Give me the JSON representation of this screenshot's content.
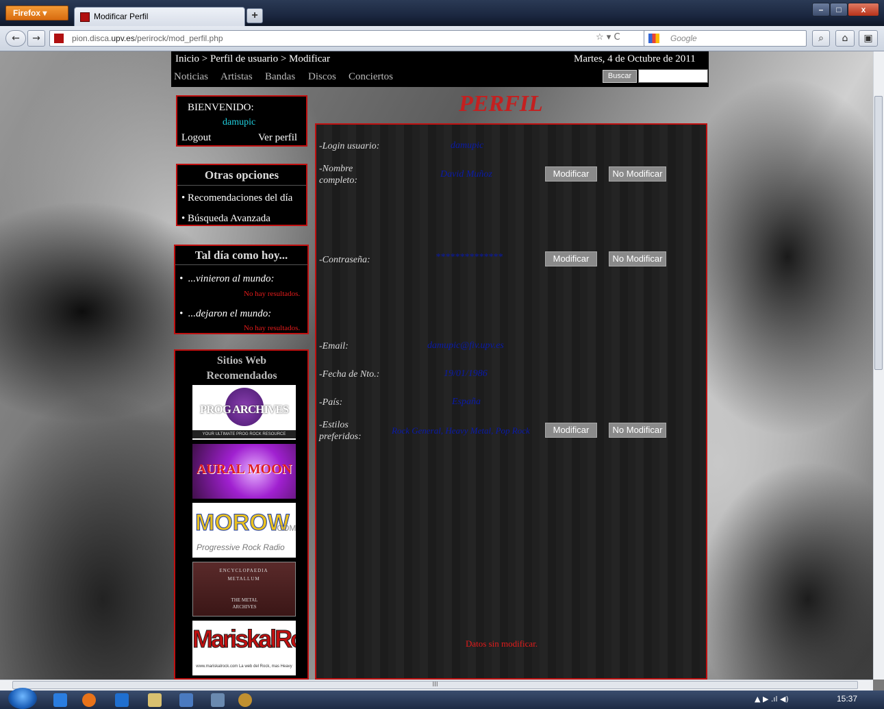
{
  "browser": {
    "app_button": "Firefox",
    "tab_title": "Modificar Perfil",
    "new_tab": "+",
    "url_prefix": "pion.disca.",
    "url_domain": "upv.es",
    "url_path": "/perirock/mod_perfil.php",
    "search_placeholder": "Google",
    "win_min": "–",
    "win_max": "□",
    "win_close": "x",
    "back": "←",
    "forward": "→",
    "home": "⌂",
    "url_tools": "☆ ▾ C",
    "search_go": "⌕",
    "addons": "▣"
  },
  "header": {
    "breadcrumb": "Inicio > Perfil de usuario > Modificar",
    "date": "Martes, 4 de Octubre de 2011",
    "menu": [
      "Noticias",
      "Artistas",
      "Bandas",
      "Discos",
      "Conciertos"
    ],
    "search_button": "Buscar"
  },
  "welcome": {
    "title": "BIENVENIDO:",
    "username": "damupic",
    "logout": "Logout",
    "view_profile": "Ver perfil"
  },
  "otras": {
    "title": "Otras opciones",
    "items": [
      "Recomendaciones del día",
      "Búsqueda Avanzada"
    ]
  },
  "tal_dia": {
    "title": "Tal día como hoy...",
    "born": "...vinieron al mundo:",
    "died": "...dejaron el mundo:",
    "no_results": "No hay resultados."
  },
  "sitios": {
    "title": "Sitios Web Recomendados",
    "banners": [
      {
        "name": "PROG ARCHIVES",
        "sub": "YOUR ULTIMATE PROG ROCK RESOURCE"
      },
      {
        "name": "AURAL MOON"
      },
      {
        "name": "MOROW",
        "sub": "Progressive Rock Radio",
        "suffix": ".COM"
      },
      {
        "name": "ENCYCLOPAEDIA METALLUM",
        "sub": "THE METAL ARCHIVES"
      },
      {
        "name": "MariskalRock",
        "sub": "www.mariskalrock.com  La web del Rock, mas Heavy"
      }
    ]
  },
  "perfil": {
    "title": "PERFIL",
    "fields": [
      {
        "label": "-Login usuario:",
        "value": "damupic"
      },
      {
        "label": "-Nombre completo:",
        "value": "David Muñoz",
        "modify": "Modificar",
        "no_modify": "No Modificar"
      },
      {
        "label": "-Contraseña:",
        "value": "**************",
        "modify": "Modificar",
        "no_modify": "No Modificar"
      },
      {
        "label": "-Email:",
        "value": "damupic@fiv.upv.es"
      },
      {
        "label": "-Fecha de Nto.:",
        "value": "19/01/1986"
      },
      {
        "label": "-País:",
        "value": "España"
      },
      {
        "label": "-Estilos preferidos:",
        "value": "Rock General, Heavy Metal, Pop Rock",
        "modify": "Modificar",
        "no_modify": "No Modificar"
      }
    ],
    "status": "Datos sin modificar."
  },
  "taskbar": {
    "clock": "15:37",
    "tray": "▲  ▶  .ıl  ◀)"
  },
  "colors": {
    "accent_red": "#c01010",
    "value_blue": "#0a1aa8",
    "error_red": "#e41b1b"
  }
}
